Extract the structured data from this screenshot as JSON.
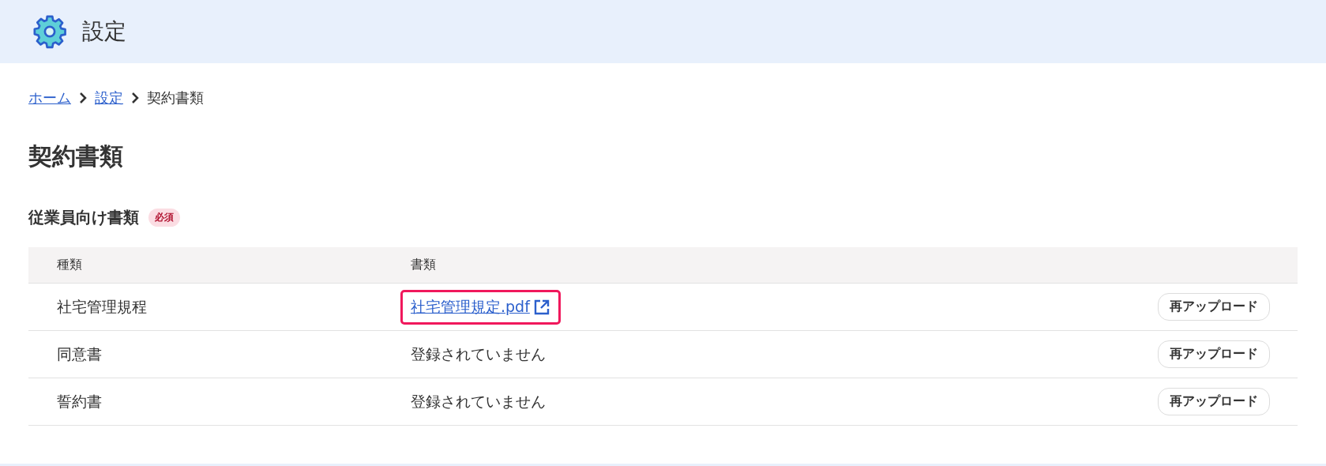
{
  "header": {
    "title": "設定"
  },
  "breadcrumb": [
    {
      "label": "ホーム",
      "kind": "link"
    },
    {
      "label": "設定",
      "kind": "link"
    },
    {
      "label": "契約書類",
      "kind": "current"
    }
  ],
  "page_title": "契約書類",
  "section": {
    "title": "従業員向け書類",
    "badge": "必須"
  },
  "table": {
    "columns": [
      "種類",
      "書類"
    ],
    "rows": [
      {
        "type": "社宅管理規程",
        "document": {
          "kind": "link",
          "text": "社宅管理規定.pdf",
          "highlighted": true
        },
        "action": "再アップロード"
      },
      {
        "type": "同意書",
        "document": {
          "kind": "text",
          "text": "登録されていません",
          "highlighted": false
        },
        "action": "再アップロード"
      },
      {
        "type": "誓約書",
        "document": {
          "kind": "text",
          "text": "登録されていません",
          "highlighted": false
        },
        "action": "再アップロード"
      }
    ]
  }
}
